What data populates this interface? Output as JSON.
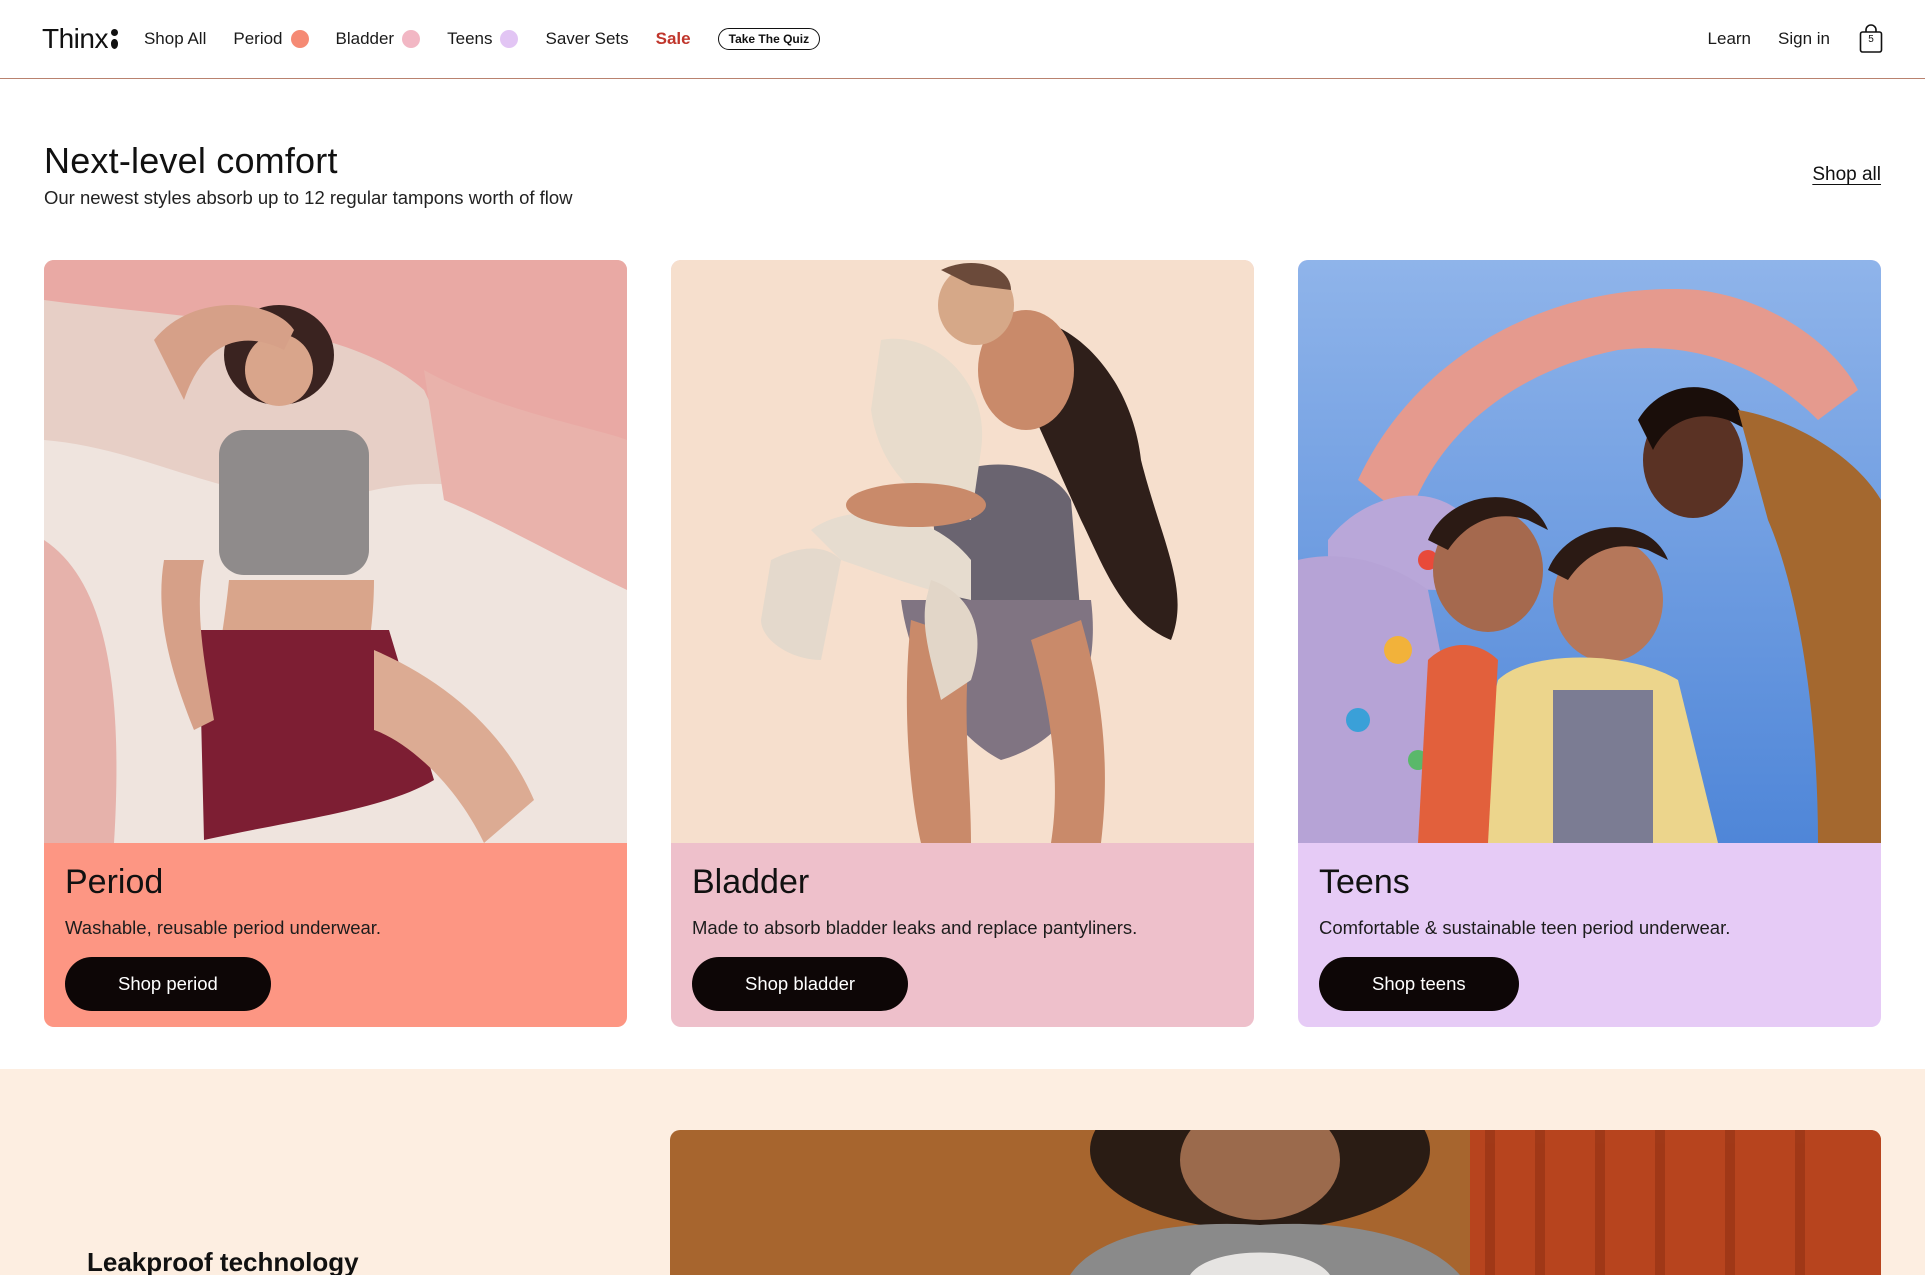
{
  "header": {
    "logo": "Thinx",
    "nav": [
      {
        "label": "Shop All",
        "dot": null
      },
      {
        "label": "Period",
        "dot": "#f58a74"
      },
      {
        "label": "Bladder",
        "dot": "#f2b7c4"
      },
      {
        "label": "Teens",
        "dot": "#e2c5f4"
      },
      {
        "label": "Saver Sets",
        "dot": null
      },
      {
        "label": "Sale",
        "dot": null
      }
    ],
    "quiz_label": "Take The Quiz",
    "learn": "Learn",
    "sign_in": "Sign in",
    "bag_count": "5"
  },
  "hero": {
    "title": "Next-level comfort",
    "subtitle": "Our newest styles absorb up to 12 regular tampons worth of flow",
    "shop_all": "Shop all"
  },
  "cards": [
    {
      "title": "Period",
      "description": "Washable, reusable period underwear.",
      "button": "Shop period",
      "color": "#fd9683"
    },
    {
      "title": "Bladder",
      "description": "Made to absorb bladder leaks and replace pantyliners.",
      "button": "Shop bladder",
      "color": "#eec0cb"
    },
    {
      "title": "Teens",
      "description": "Comfortable & sustainable teen period underwear.",
      "button": "Shop teens",
      "color": "#e6cbf6"
    }
  ],
  "bottom": {
    "title": "Leakproof technology"
  }
}
